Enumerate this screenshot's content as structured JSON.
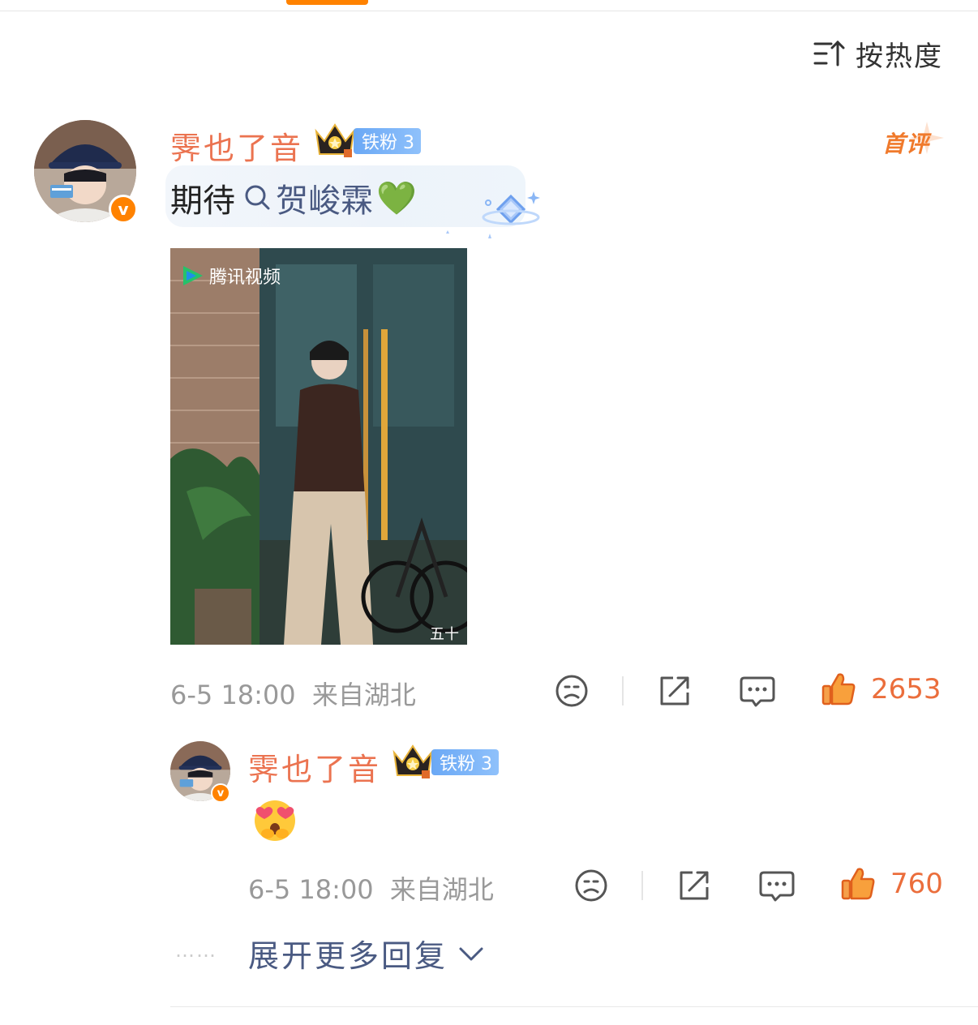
{
  "sort": {
    "label": "按热度",
    "icon": "sort-icon"
  },
  "comment": {
    "username": "霁也了音",
    "fan_badge": "铁粉 3",
    "first_tag": "首评",
    "text_prefix": "期待",
    "topic": "贺峻霖",
    "emoji": "💚",
    "image_watermark": "腾讯视频",
    "image_corner_text": "五十",
    "time": "6-5 18:00",
    "location": "来自湖北",
    "like_count": "2653"
  },
  "reply": {
    "username": "霁也了音",
    "fan_badge": "铁粉 3",
    "time": "6-5 18:00",
    "location": "来自湖北",
    "like_count": "760"
  },
  "expand_replies": {
    "dots": "……",
    "label": "展开更多回复"
  },
  "colors": {
    "accent": "#ff8200",
    "username": "#eb7350",
    "link": "#4a5a82",
    "like": "#eb6e3c",
    "badge": "#6aa8f5"
  }
}
